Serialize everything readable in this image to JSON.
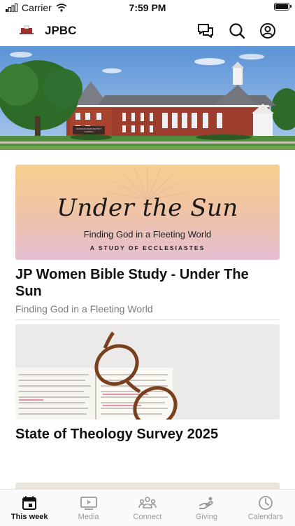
{
  "status_bar": {
    "carrier": "Carrier",
    "time": "7:59 PM",
    "battery_level": 1.0
  },
  "header": {
    "title": "JPBC",
    "logo_icon": "church-logo-icon",
    "icons": [
      "messages-icon",
      "search-icon",
      "profile-icon"
    ]
  },
  "hero": {
    "sign_text": "JACKSON PARK BAPTIST CHURCH"
  },
  "cards": [
    {
      "image": {
        "title": "Under the Sun",
        "subtitle": "Finding God in a Fleeting World",
        "tagline": "A STUDY OF ECCLESIASTES"
      },
      "title": "JP Women Bible Study - Under The Sun",
      "subtitle": "Finding God in a Fleeting World"
    },
    {
      "title": "State of Theology Survey 2025"
    }
  ],
  "tab_bar": {
    "active": "This week",
    "tabs": [
      {
        "label": "This week",
        "icon": "calendar-icon"
      },
      {
        "label": "Media",
        "icon": "media-icon"
      },
      {
        "label": "Connect",
        "icon": "connect-icon"
      },
      {
        "label": "Giving",
        "icon": "giving-icon"
      },
      {
        "label": "Calendars",
        "icon": "clock-icon"
      }
    ]
  },
  "colors": {
    "accent": "#111111",
    "inactive": "#9a9a9a"
  }
}
